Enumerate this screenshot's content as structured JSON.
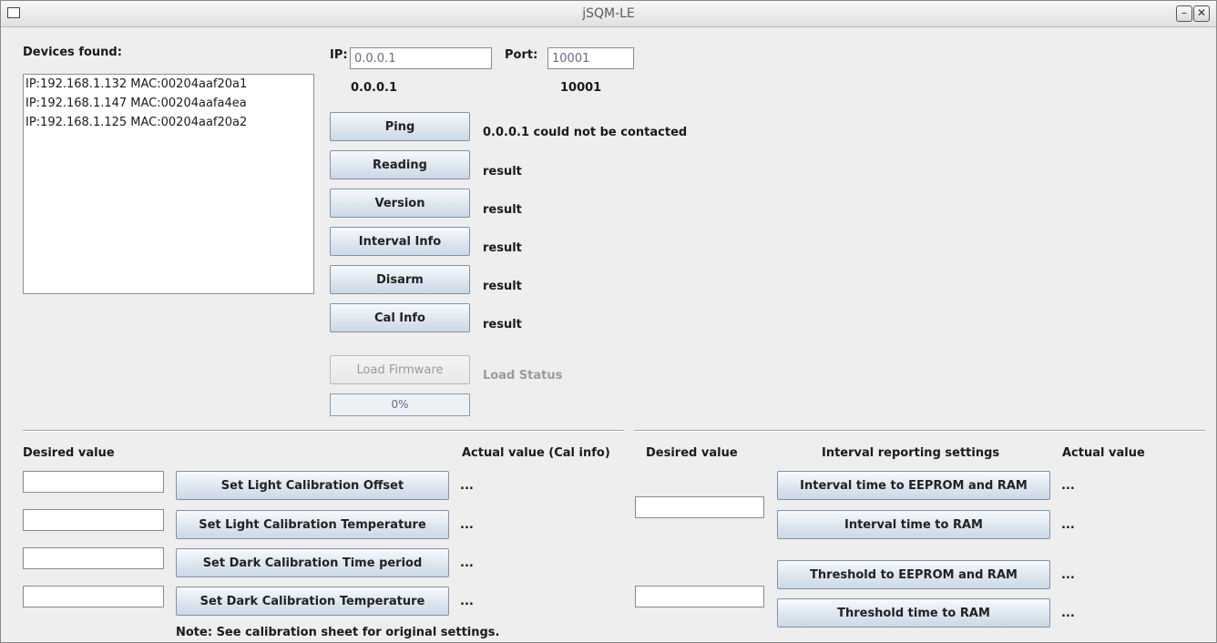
{
  "window": {
    "title": "jSQM-LE",
    "minimize_glyph": "–",
    "close_glyph": "✕"
  },
  "devices": {
    "label": "Devices found:",
    "items": [
      "IP:192.168.1.132  MAC:00204aaf20a1",
      "IP:192.168.1.147  MAC:00204aafa4ea",
      "IP:192.168.1.125  MAC:00204aaf20a2"
    ]
  },
  "connection": {
    "ip_label": "IP:",
    "ip_value": "0.0.0.1",
    "ip_display": "0.0.0.1",
    "port_label": "Port:",
    "port_value": "10001",
    "port_display": "10001"
  },
  "commands": [
    {
      "label": "Ping",
      "result": "0.0.0.1 could not be contacted"
    },
    {
      "label": "Reading",
      "result": "result"
    },
    {
      "label": "Version",
      "result": "result"
    },
    {
      "label": "Interval Info",
      "result": "result"
    },
    {
      "label": "Disarm",
      "result": "result"
    },
    {
      "label": "Cal Info",
      "result": "result"
    }
  ],
  "firmware": {
    "button_label": "Load Firmware",
    "status": "Load Status",
    "progress_text": "0%",
    "progress_fraction": 0
  },
  "calibration": {
    "desired_header": "Desired value",
    "actual_header": "Actual value (Cal info)",
    "rows": [
      {
        "button": "Set Light Calibration Offset",
        "desired": "",
        "actual": "..."
      },
      {
        "button": "Set Light Calibration Temperature",
        "desired": "",
        "actual": "..."
      },
      {
        "button": "Set Dark Calibration Time period",
        "desired": "",
        "actual": "..."
      },
      {
        "button": "Set Dark Calibration Temperature",
        "desired": "",
        "actual": "..."
      }
    ],
    "note": "Note: See calibration sheet for original settings."
  },
  "interval": {
    "desired_header": "Desired value",
    "settings_header": "Interval reporting settings",
    "actual_header": "Actual value",
    "interval_desired": "",
    "threshold_desired": "",
    "buttons": [
      {
        "label": "Interval time to EEPROM and RAM",
        "actual": "..."
      },
      {
        "label": "Interval time to RAM",
        "actual": "..."
      },
      {
        "label": "Threshold to EEPROM and RAM",
        "actual": "..."
      },
      {
        "label": "Threshold time to RAM",
        "actual": "..."
      }
    ]
  },
  "icons": [
    "window-menu-icon",
    "minimize-icon",
    "close-icon"
  ]
}
